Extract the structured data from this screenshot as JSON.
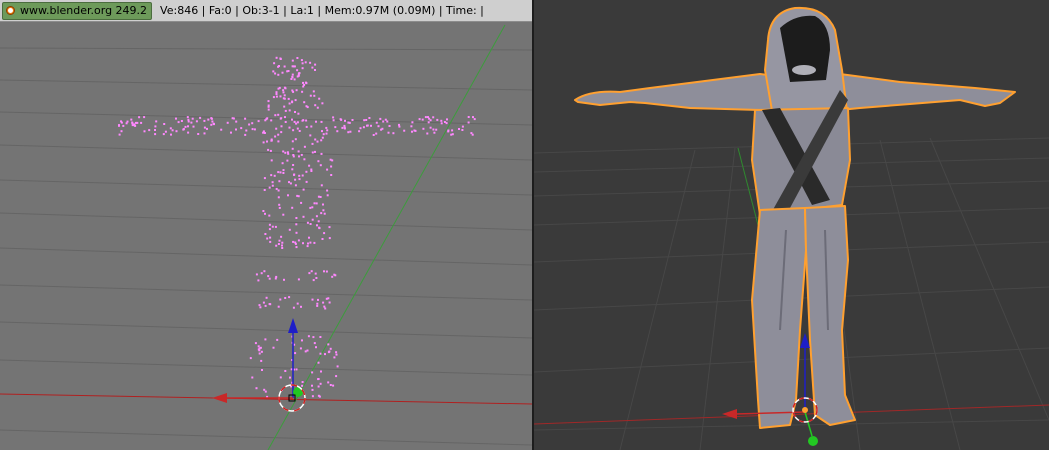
{
  "info_header": {
    "logo_label": "www.blender.org 249.2",
    "stats": "Ve:846 | Fa:0 | Ob:3-1 | La:1  | Mem:0.97M (0.09M)  | Time: |"
  },
  "left_viewport": {
    "mode": "Edit Mode",
    "background_color": "#747474",
    "vertex_color": "#ff88ff",
    "x_axis_color": "#b02020",
    "y_axis_color": "#3c9c3c"
  },
  "right_viewport": {
    "mode": "Object Mode",
    "background_color": "#3a3a3a",
    "selection_outline_color": "#ffa030",
    "x_axis_color": "#c82828",
    "z_axis_color": "#1e1ec8"
  },
  "icons": {
    "logo": "blender-logo-icon",
    "manipulator": "transform-manipulator-icon",
    "cursor": "3d-cursor-icon"
  }
}
